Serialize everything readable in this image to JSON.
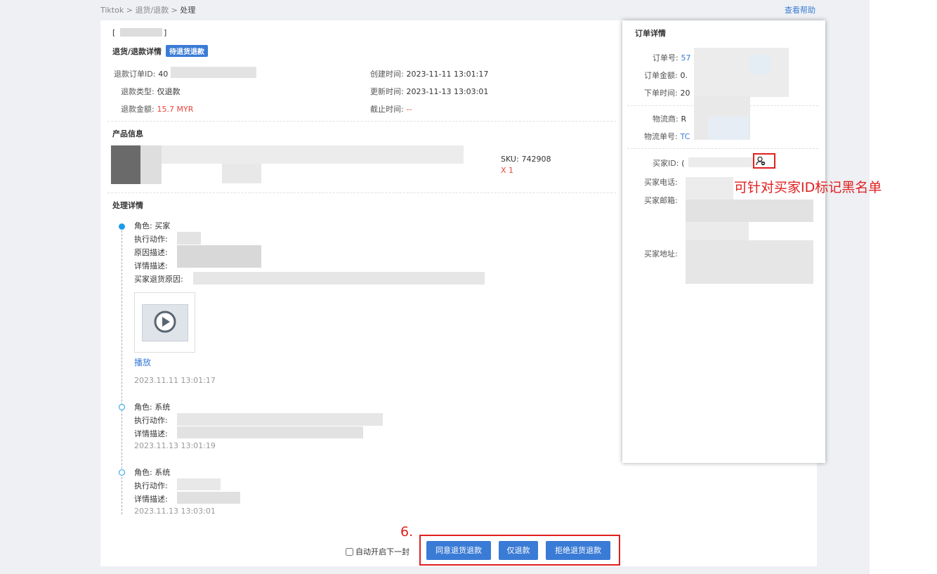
{
  "breadcrumb": {
    "items": [
      "Tiktok",
      "退货/退款",
      "处理"
    ],
    "sep": ">"
  },
  "help_link": "查看帮助",
  "header": {
    "bracket_open": "[",
    "bracket_close": "]"
  },
  "details": {
    "title": "退货/退款详情",
    "status_badge": "待退货退款",
    "refund_id_label": "退款订单ID:",
    "refund_id_value": "40",
    "refund_type_label": "退款类型:",
    "refund_type_value": "仅退款",
    "refund_amount_label": "退款金额:",
    "refund_amount_value": "15.7 MYR",
    "created_label": "创建时间:",
    "created_value": "2023-11-11 13:01:17",
    "updated_label": "更新时间:",
    "updated_value": "2023-11-13 13:03:01",
    "deadline_label": "截止时间:",
    "deadline_value": "--"
  },
  "product": {
    "title": "产品信息",
    "sku_label": "SKU:",
    "sku_value": "742908",
    "qty": "X 1"
  },
  "process": {
    "title": "处理详情",
    "entries": [
      {
        "role": "角色:  买家",
        "action": "执行动作:",
        "reason": "原因描述:",
        "detail": "详情描述:",
        "buyer_reason": "买家退货原因:",
        "play": "播放",
        "time": "2023.11.11 13:01:17"
      },
      {
        "role": "角色:  系统",
        "action": "执行动作:",
        "detail": "详情描述:",
        "time": "2023.11.13 13:01:19"
      },
      {
        "role": "角色:  系统",
        "action": "执行动作:",
        "detail": "详情描述:",
        "time": "2023.11.13 13:03:01"
      }
    ]
  },
  "footer": {
    "auto_next_label": "自动开启下一封",
    "auto_next_checked": false,
    "btn_agree": "同意退货退款",
    "btn_refund_only": "仅退款",
    "btn_reject": "拒绝退货退款"
  },
  "order_panel": {
    "title": "订单详情",
    "order_no_label": "订单号:",
    "order_no_value": "57",
    "order_amount_label": "订单金额:",
    "order_amount_value": "0.",
    "order_time_label": "下单时间:",
    "order_time_value": "20",
    "carrier_label": "物流商:",
    "carrier_value": "R",
    "tracking_label": "物流单号:",
    "tracking_value": "TC",
    "buyer_id_label": "买家ID:",
    "buyer_id_value": "(",
    "buyer_phone_label": "买家电话:",
    "buyer_email_label": "买家邮箱:",
    "buyer_address_label": "买家地址:"
  },
  "annotations": {
    "step_number": "6.",
    "blacklist_note": "可针对买家ID标记黑名单"
  },
  "colors": {
    "accent": "#3a7bd5",
    "annotation": "#e02020",
    "timeline": "#1e9be8",
    "danger_text": "#e8453c"
  }
}
